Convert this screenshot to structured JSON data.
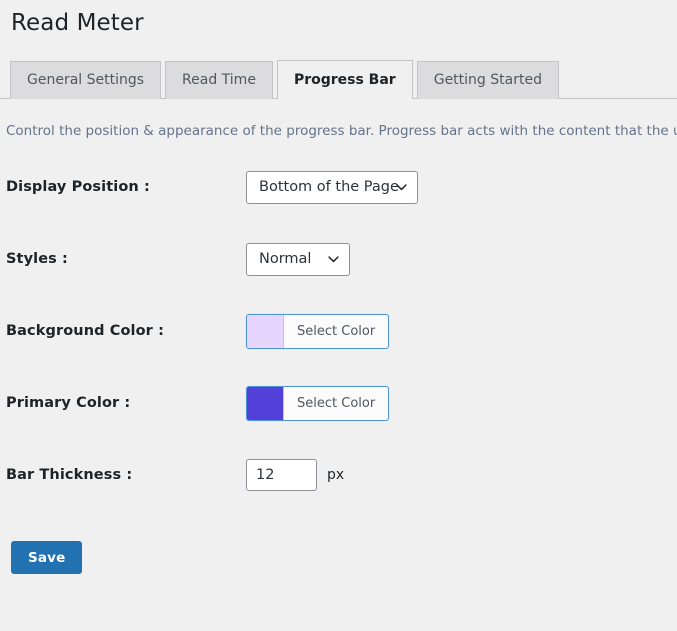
{
  "page": {
    "title": "Read Meter"
  },
  "tabs": [
    {
      "label": "General Settings",
      "active": false
    },
    {
      "label": "Read Time",
      "active": false
    },
    {
      "label": "Progress Bar",
      "active": true
    },
    {
      "label": "Getting Started",
      "active": false
    }
  ],
  "description": "Control the position & appearance of the progress bar. Progress bar acts with the content that the user has",
  "fields": {
    "display_position": {
      "label": "Display Position :",
      "value": "Bottom of the Page"
    },
    "styles": {
      "label": "Styles :",
      "value": "Normal"
    },
    "background_color": {
      "label": "Background Color :",
      "button_label": "Select Color",
      "swatch": "#e6d6fd"
    },
    "primary_color": {
      "label": "Primary Color :",
      "button_label": "Select Color",
      "swatch": "#5340d8"
    },
    "bar_thickness": {
      "label": "Bar Thickness :",
      "value": "12",
      "placeholder": "",
      "unit": "px"
    }
  },
  "actions": {
    "save_label": "Save"
  },
  "colors": {
    "page_background": "#f0f0f1",
    "tab_inactive_background": "#dcdcde",
    "tab_active_background": "#f0f0f1",
    "border": "#c3c4c7",
    "primary_button": "#2271b1",
    "color_picker_border": "#4f94d4",
    "text": "#1d2327",
    "muted_text": "#64748b"
  }
}
